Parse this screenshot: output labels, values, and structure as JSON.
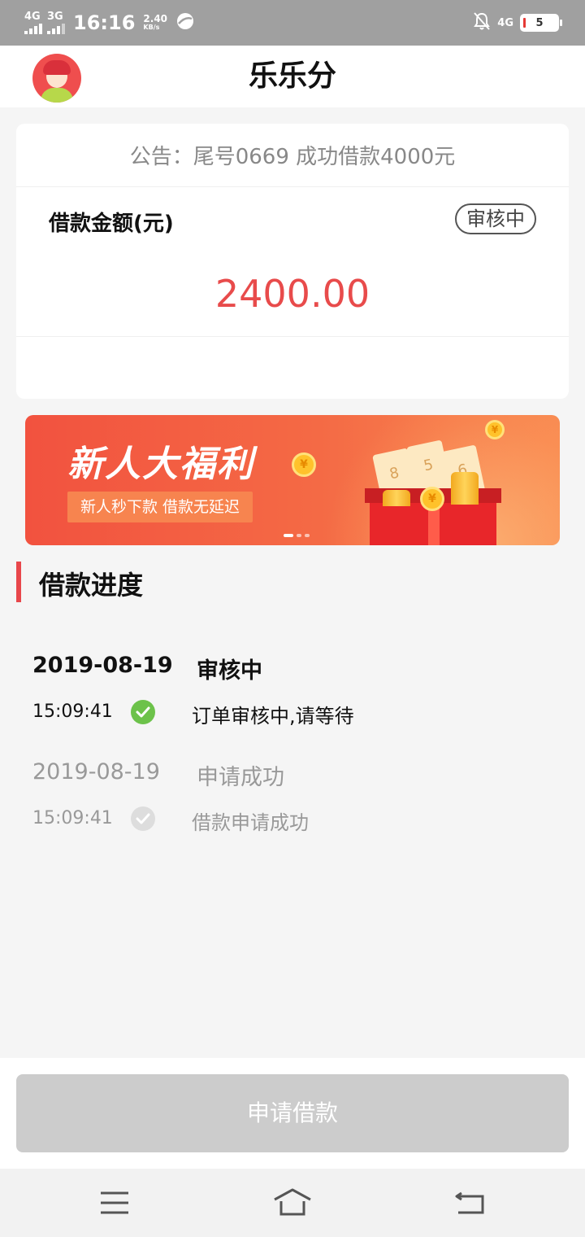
{
  "status_bar": {
    "network1": "4G",
    "network2": "3G",
    "time": "16:16",
    "speed_value": "2.40",
    "speed_unit": "KB/s",
    "network_right": "4G",
    "battery": "5"
  },
  "header": {
    "title": "乐乐分"
  },
  "loan_card": {
    "notice": "公告：尾号0669 成功借款4000元",
    "amount_label": "借款金额(元)",
    "status": "审核中",
    "amount": "2400.00"
  },
  "banner": {
    "title": "新人大福利",
    "subtitle": "新人秒下款  借款无延迟",
    "ticket_digits": [
      "8",
      "5",
      "6"
    ],
    "coin_symbol": "¥",
    "slides_total": 3,
    "active_slide": 1
  },
  "progress": {
    "section_title": "借款进度",
    "steps": [
      {
        "date": "2019-08-19",
        "time": "15:09:41",
        "status": "审核中",
        "description": "订单审核中,请等待",
        "state": "active",
        "icon": "check-circle-icon",
        "color": "#6cc24a"
      },
      {
        "date": "2019-08-19",
        "time": "15:09:41",
        "status": "申请成功",
        "description": "借款申请成功",
        "state": "done",
        "icon": "check-circle-icon",
        "color": "#dddddd"
      }
    ]
  },
  "bottom": {
    "apply_button": "申请借款"
  },
  "colors": {
    "accent_red": "#e84b4b",
    "check_green": "#6cc24a",
    "disabled_button": "#cccccc"
  },
  "nav_icons": [
    "menu-icon",
    "home-icon",
    "back-icon"
  ]
}
